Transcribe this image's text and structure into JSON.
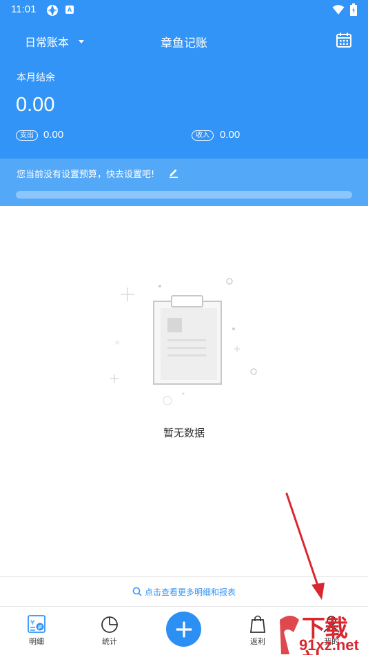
{
  "status_bar": {
    "time": "11:01",
    "badge_letter": "A"
  },
  "header": {
    "book_selector": "日常账本",
    "app_title": "章鱼记账",
    "balance_label": "本月结余",
    "balance_value": "0.00",
    "expense_label": "支出",
    "expense_value": "0.00",
    "income_label": "收入",
    "income_value": "0.00"
  },
  "budget": {
    "text": "您当前没有设置预算，快去设置吧!",
    "progress": 0
  },
  "empty_state": {
    "text": "暂无数据"
  },
  "report_link": {
    "text": "点击查看更多明细和报表"
  },
  "bottom_nav": [
    {
      "label": "明细",
      "icon": "ledger-icon"
    },
    {
      "label": "统计",
      "icon": "pie-chart-icon"
    },
    {
      "label": "返利",
      "icon": "shopping-bag-icon"
    },
    {
      "label": "我的",
      "icon": "user-icon"
    }
  ],
  "add_button": {
    "icon": "plus-icon"
  },
  "watermark": {
    "top": "下载站",
    "bottom": "91xz.net"
  },
  "colors": {
    "primary": "#3294f6",
    "banner": "#53a8f7",
    "annotation": "#d8282f"
  }
}
